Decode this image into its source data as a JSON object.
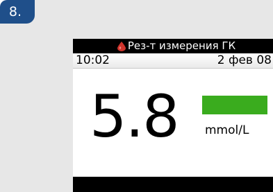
{
  "step": {
    "label": "8."
  },
  "screen": {
    "title": "Рез-т измерения ГК",
    "title_icon": "blood-drop-icon",
    "time": "10:02",
    "date": "2 фев 08",
    "glucose_value": "5.8",
    "unit": "mmol/L",
    "range_indicator_color": "#3aac1e"
  },
  "colors": {
    "badge": "#1f4f8a",
    "panel_bg": "#e7e7e7",
    "drop": "#d0342c"
  }
}
